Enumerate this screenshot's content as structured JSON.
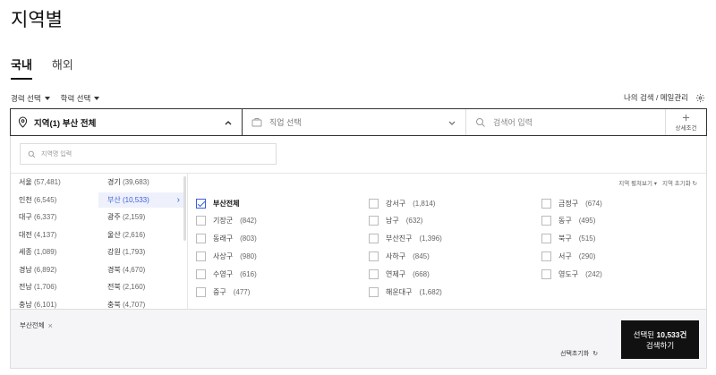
{
  "page_title": "지역별",
  "tabs": [
    {
      "label": "국내",
      "active": true
    },
    {
      "label": "해외",
      "active": false
    }
  ],
  "filters": {
    "career": "경력 선택",
    "education": "학력 선택"
  },
  "right_tools": {
    "my_search": "나의 검색 / 메일관리",
    "icon": "gear-icon"
  },
  "searchbar": {
    "region_label": "지역(1) 부산 전체",
    "region_icon": "location-pin-icon",
    "job_placeholder": "직업 선택",
    "job_icon": "briefcase-icon",
    "keyword_placeholder": "검색어 입력",
    "keyword_icon": "search-icon",
    "detail_label": "상세조건",
    "detail_icon": "plus-icon"
  },
  "region_search": {
    "placeholder": "지역명 입력"
  },
  "left_regions": [
    {
      "name": "서울",
      "count": "(57,481)"
    },
    {
      "name": "경기",
      "count": "(39,683)"
    },
    {
      "name": "인천",
      "count": "(6,545)"
    },
    {
      "name": "부산",
      "count": "(10,533)",
      "selected": true
    },
    {
      "name": "대구",
      "count": "(6,337)"
    },
    {
      "name": "광주",
      "count": "(2,159)"
    },
    {
      "name": "대전",
      "count": "(4,137)"
    },
    {
      "name": "울산",
      "count": "(2,616)"
    },
    {
      "name": "세종",
      "count": "(1,089)"
    },
    {
      "name": "강원",
      "count": "(1,793)"
    },
    {
      "name": "경남",
      "count": "(6,892)"
    },
    {
      "name": "경북",
      "count": "(4,670)"
    },
    {
      "name": "전남",
      "count": "(1,706)"
    },
    {
      "name": "전북",
      "count": "(2,160)"
    },
    {
      "name": "충남",
      "count": "(6,101)"
    },
    {
      "name": "충북",
      "count": "(4,707)"
    }
  ],
  "sub_tools": {
    "collapse": "지역 펼쳐보기",
    "reset": "지역 초기화"
  },
  "sub_regions": [
    {
      "name": "부산전체",
      "count": "",
      "checked": true
    },
    {
      "name": "강서구",
      "count": "(1,814)"
    },
    {
      "name": "금정구",
      "count": "(674)"
    },
    {
      "name": "기장군",
      "count": "(842)"
    },
    {
      "name": "남구",
      "count": "(632)"
    },
    {
      "name": "동구",
      "count": "(495)"
    },
    {
      "name": "동래구",
      "count": "(803)"
    },
    {
      "name": "부산진구",
      "count": "(1,396)"
    },
    {
      "name": "북구",
      "count": "(515)"
    },
    {
      "name": "사상구",
      "count": "(980)"
    },
    {
      "name": "사하구",
      "count": "(845)"
    },
    {
      "name": "서구",
      "count": "(290)"
    },
    {
      "name": "수영구",
      "count": "(616)"
    },
    {
      "name": "연제구",
      "count": "(668)"
    },
    {
      "name": "영도구",
      "count": "(242)"
    },
    {
      "name": "중구",
      "count": "(477)"
    },
    {
      "name": "해운대구",
      "count": "(1,682)"
    }
  ],
  "selection": {
    "chip_label": "부산전체",
    "reset_label": "선택초기화",
    "button_line1_prefix": "선택된 ",
    "button_count": "10,533건",
    "button_line2": "검색하기"
  }
}
